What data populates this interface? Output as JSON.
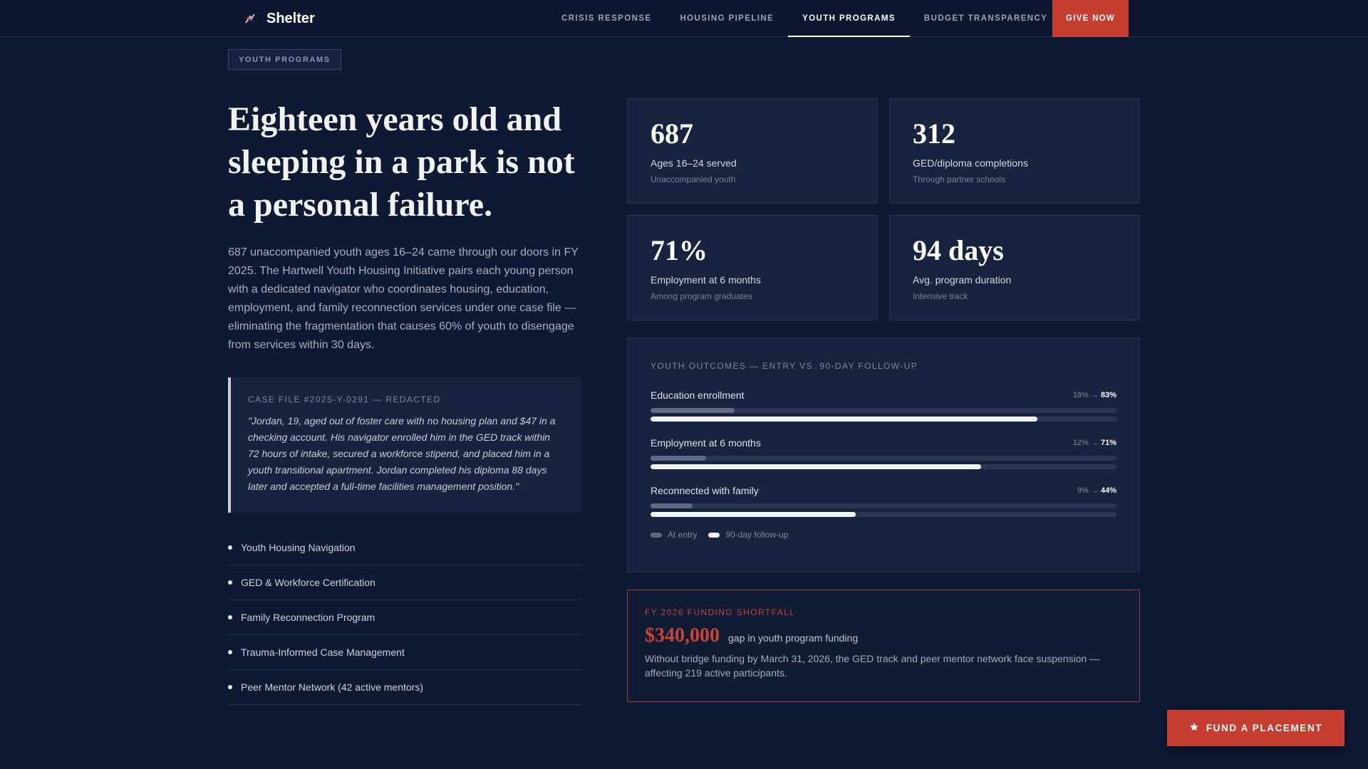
{
  "nav": {
    "brand": "Shelter",
    "links": [
      {
        "label": "Crisis Response",
        "active": false
      },
      {
        "label": "Housing Pipeline",
        "active": false
      },
      {
        "label": "Youth Programs",
        "active": true
      },
      {
        "label": "Budget Transparency",
        "active": false
      }
    ],
    "give_label": "Give Now"
  },
  "tag": "Youth Programs",
  "hero": {
    "headline": "Eighteen years old and sleeping in a park is not a personal failure.",
    "lead": "687 unaccompanied youth ages 16–24 came through our doors in FY 2025. The Hartwell Youth Housing Initiative pairs each young person with a dedicated navigator who coordinates housing, education, employment, and family reconnection services under one case file — eliminating the fragmentation that causes 60% of youth to disengage from services within 30 days."
  },
  "case_file": {
    "label": "Case File #2025-Y-0291 — Redacted",
    "quote": "\"Jordan, 19, aged out of foster care with no housing plan and $47 in a checking account. His navigator enrolled him in the GED track within 72 hours of intake, secured a workforce stipend, and placed him in a youth transitional apartment. Jordan completed his diploma 88 days later and accepted a full-time facilities management position.\""
  },
  "programs": [
    "Youth Housing Navigation",
    "GED & Workforce Certification",
    "Family Reconnection Program",
    "Trauma-Informed Case Management",
    "Peer Mentor Network (42 active mentors)"
  ],
  "stats": [
    {
      "value": "687",
      "label": "Ages 16–24 served",
      "sub": "Unaccompanied youth"
    },
    {
      "value": "312",
      "label": "GED/diploma completions",
      "sub": "Through partner schools"
    },
    {
      "value": "71%",
      "label": "Employment at 6 months",
      "sub": "Among program graduates"
    },
    {
      "value": "94 days",
      "label": "Avg. program duration",
      "sub": "Intensive track"
    }
  ],
  "outcomes": {
    "title": "Youth Outcomes — Entry vs. 90-Day Follow-Up",
    "metrics": [
      {
        "name": "Education enrollment",
        "entry": 18,
        "followup": 83,
        "entry_label": "18%",
        "followup_label": "83%"
      },
      {
        "name": "Employment at 6 months",
        "entry": 12,
        "followup": 71,
        "entry_label": "12%",
        "followup_label": "71%"
      },
      {
        "name": "Reconnected with family",
        "entry": 9,
        "followup": 44,
        "entry_label": "9%",
        "followup_label": "44%"
      }
    ],
    "arrow": "→",
    "legend_entry": "At entry",
    "legend_followup": "90-day follow-up"
  },
  "funding": {
    "label": "FY 2026 Funding Shortfall",
    "amount": "$340,000",
    "caption": "gap in youth program funding",
    "body": "Without bridge funding by March 31, 2026, the GED track and peer mentor network face suspension — affecting 219 active participants."
  },
  "cta_label": "Fund a Placement",
  "colors": {
    "background": "#0e1a33",
    "accent": "#c63d31",
    "card": "#17233f"
  }
}
